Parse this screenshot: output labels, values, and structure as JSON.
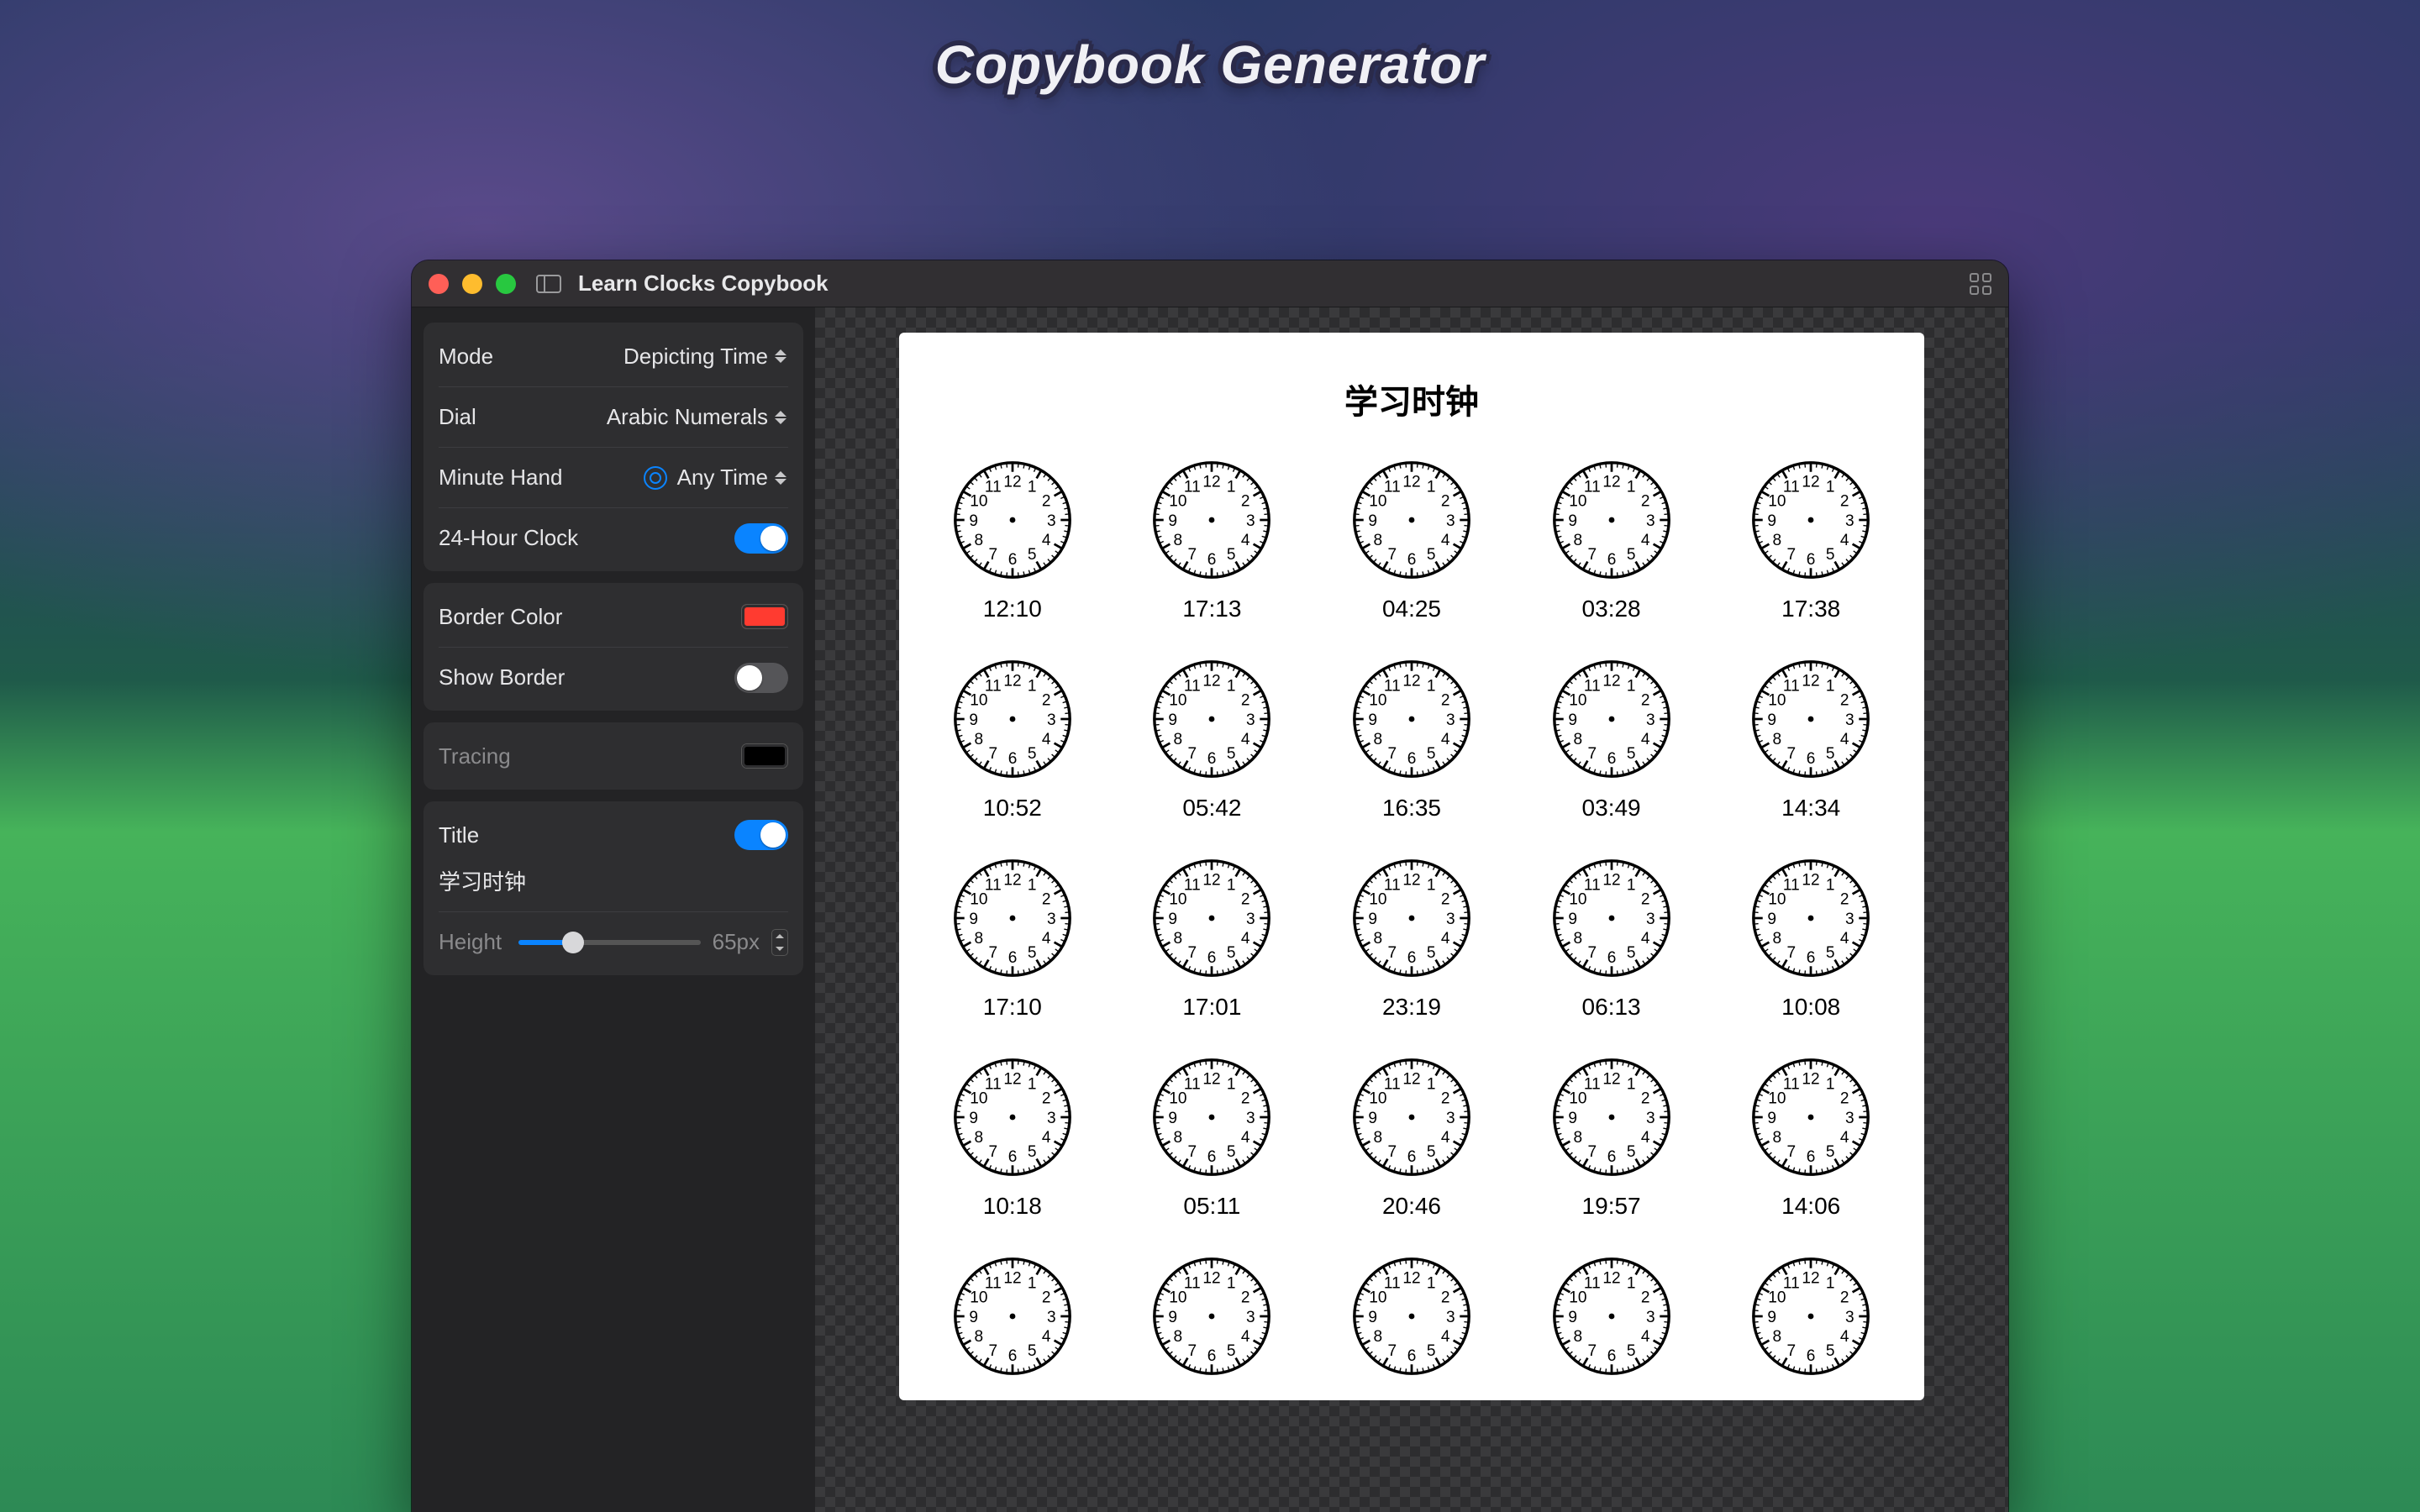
{
  "hero": {
    "title": "Copybook Generator"
  },
  "window": {
    "title": "Learn Clocks Copybook"
  },
  "sidebar": {
    "mode": {
      "label": "Mode",
      "value": "Depicting Time"
    },
    "dial": {
      "label": "Dial",
      "value": "Arabic Numerals"
    },
    "minute_hand": {
      "label": "Minute Hand",
      "value": "Any Time"
    },
    "clock24": {
      "label": "24-Hour Clock",
      "on": true
    },
    "border_color": {
      "label": "Border Color",
      "value": "#FF3B30"
    },
    "show_border": {
      "label": "Show Border",
      "on": false
    },
    "tracing": {
      "label": "Tracing",
      "value": "#000000"
    },
    "title": {
      "label": "Title",
      "on": true,
      "text": "学习时钟"
    },
    "height": {
      "label": "Height",
      "value": "65px"
    }
  },
  "page": {
    "title": "学习时钟",
    "clocks": [
      "12:10",
      "17:13",
      "04:25",
      "03:28",
      "17:38",
      "10:52",
      "05:42",
      "16:35",
      "03:49",
      "14:34",
      "17:10",
      "17:01",
      "23:19",
      "06:13",
      "10:08",
      "10:18",
      "05:11",
      "20:46",
      "19:57",
      "14:06",
      "",
      "",
      "",
      "",
      ""
    ]
  }
}
